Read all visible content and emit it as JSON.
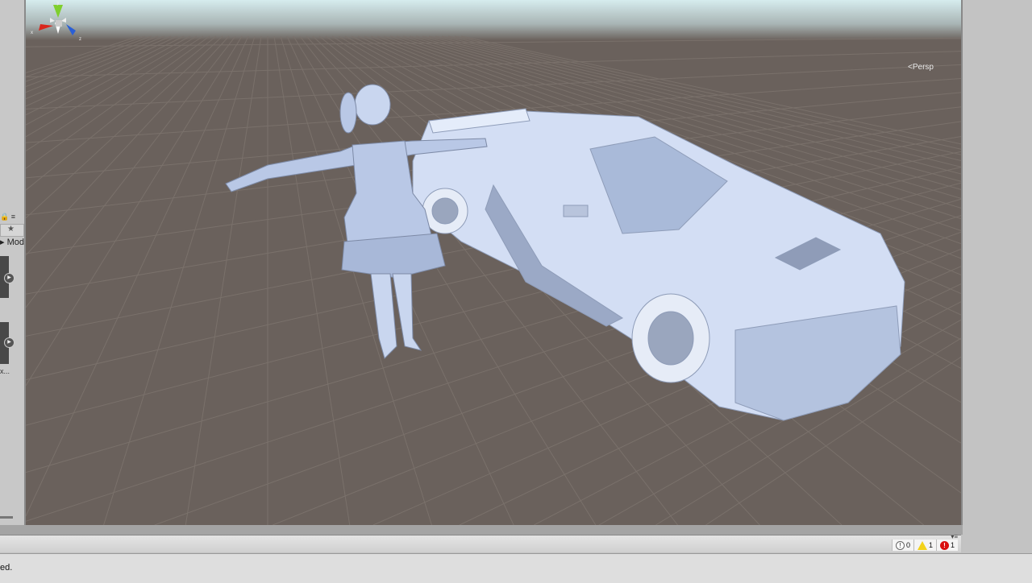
{
  "left_panel": {
    "toolbar_icons": [
      "lock-icon",
      "menu-icon"
    ],
    "favorites_icon": "star-icon",
    "label": "Mod",
    "truncated_item": "x..."
  },
  "scene": {
    "projection_label": "Persp",
    "gizmo_axes": {
      "x": "x",
      "y": "y",
      "z": "z"
    },
    "colors": {
      "floor": "#6a615c",
      "sky": "#cfe3e6",
      "model": "#c8d6f0",
      "x_axis": "#d9261c",
      "y_axis": "#7fcf2e",
      "z_axis": "#2a5fd6"
    }
  },
  "console": {
    "info_count": "0",
    "warning_count": "1",
    "error_count": "1",
    "status_message": "ed."
  }
}
